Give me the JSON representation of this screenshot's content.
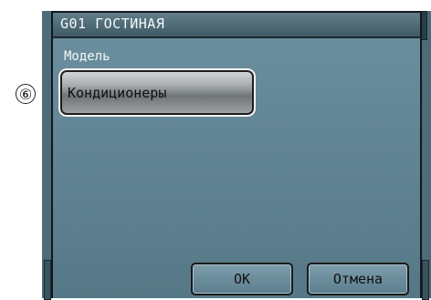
{
  "callout": {
    "number": "⑥"
  },
  "dialog": {
    "title": "G01 ГОСТИНАЯ",
    "model_label": "Модель",
    "model_value": "Кондиционеры",
    "ok_label": "OK",
    "cancel_label": "Отмена"
  }
}
